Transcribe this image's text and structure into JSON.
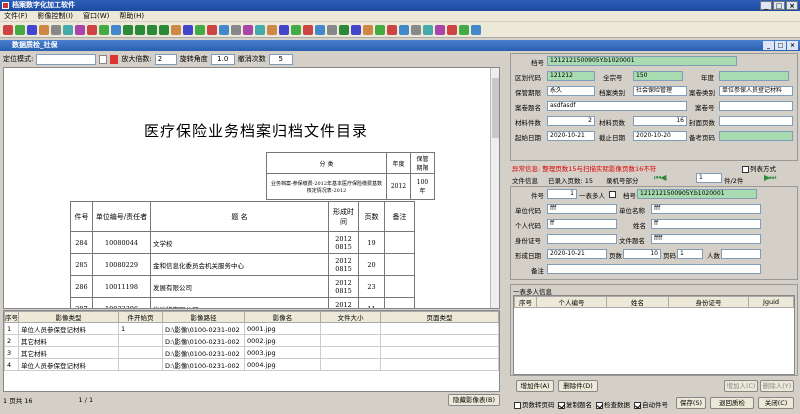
{
  "app": {
    "title": "档案数字化加工软件"
  },
  "menu": [
    "文件(F)",
    "影像控制(I)",
    "窗口(W)",
    "帮助(H)"
  ],
  "window": {
    "title": "数据质检_社保"
  },
  "controls": {
    "locate_label": "定位模式:",
    "zoom_label": "放大倍数:",
    "zoom_value": "2",
    "rotate_label": "旋转角度",
    "rotate_value": "1.0",
    "undo_label": "撤消次数",
    "undo_value": "5"
  },
  "document": {
    "title": "医疗保险业务档案归档文件目录",
    "cat_header": [
      "分 类",
      "年度",
      "保管期限"
    ],
    "cat_row": [
      "业务档案-参保缴费-2012年基本医疗保险缴费基数核定情况表-2012",
      "2012",
      "100年"
    ],
    "headers": [
      "件号",
      "单位编号/责任者",
      "题 名",
      "形成时间",
      "页数",
      "备注"
    ],
    "rows": [
      [
        "284",
        "10080044",
        "文学校",
        "2012 0815",
        "19",
        ""
      ],
      [
        "285",
        "10080229",
        "金和信息化委员会机关服务中心",
        "2012 0815",
        "20",
        ""
      ],
      [
        "286",
        "10011198",
        "发展有限公司",
        "2012 0815",
        "23",
        ""
      ],
      [
        "287",
        "10033396",
        "发动物有限公司",
        "2012 0815",
        "11",
        ""
      ]
    ]
  },
  "image_grid": {
    "headers": [
      "序号",
      "影像类型",
      "件开始页",
      "影像路径",
      "影像名",
      "文件大小",
      "页面类型"
    ],
    "rows": [
      [
        "1",
        "单位人员参保登记材料",
        "1",
        "D:\\影像\\0100-0231-002",
        "0001.jpg",
        "",
        ""
      ],
      [
        "2",
        "其它材料",
        "",
        "D:\\影像\\0100-0231-002",
        "0002.jpg",
        "",
        ""
      ],
      [
        "3",
        "其它材料",
        "",
        "D:\\影像\\0100-0231-002",
        "0003.jpg",
        "",
        ""
      ],
      [
        "4",
        "单位人员参保登记材料",
        "",
        "D:\\影像\\0100-0231-002",
        "0004.jpg",
        "",
        ""
      ]
    ]
  },
  "status": {
    "pages_label": "1  页共  16",
    "page_of": "1 / 1",
    "hide_button": "隐藏影像表(B)"
  },
  "record": {
    "dh_label": "档号",
    "dh": "1212121500905Y.b1020001",
    "qh_label": "区划代码",
    "qh": "121212",
    "qzh_label": "全宗号",
    "qzh": "150",
    "nd_label": "年度",
    "bgqx_label": "保管期限",
    "bgqx": "永久",
    "dalb_label": "档案类别",
    "dalb": "社会保险管理",
    "dalb2_label": "案卷类别",
    "dalb2": "单位参保人员登记材料",
    "ajtm_label": "案卷题名",
    "ajtm": "asdfasdf",
    "ajh_label": "案卷号",
    "clj_label": "材料件数",
    "clj": "2",
    "clys_label": "材料页数",
    "clys": "16",
    "fmys_label": "封面页数",
    "qsrq_label": "起始日期",
    "qsrq": "2020-10-21",
    "jzrq_label": "截止日期",
    "jzrq": "2020-10-20",
    "bbym_label": "备考页码"
  },
  "alert": "异常信息: 整理页数15与扫描实际影像页数16不符",
  "list_mode": "列表方式",
  "file_info": {
    "label": "文件信息",
    "entered": "已录入页数: 15",
    "entry_part": "录机号部分",
    "page": "1",
    "page_of": "件/2件"
  },
  "file_form": {
    "jh_label": "件号",
    "jh": "1",
    "one_table": "一表多人",
    "dh_label": "档号",
    "dh": "1212121500905Y.b1020001",
    "dwdm_label": "单位代码",
    "dwdm": "fff",
    "dwmc_label": "单位名称",
    "dwmc": "fff",
    "grdm_label": "个人代码",
    "grdm": "ff",
    "xm_label": "姓名",
    "xm": "ff",
    "sfz_label": "身份证号",
    "wjtm_label": "文件题名",
    "wjtm": "ffff",
    "xcrq_label": "形成日期",
    "xcrq": "2020-10-21",
    "ys_label": "页数",
    "ys": "10",
    "yh_label": "页码",
    "yh": "1",
    "rs_label": "人数",
    "bz_label": "备注"
  },
  "multi": {
    "title": "一表多人信息",
    "headers": [
      "序号",
      "个人编号",
      "姓名",
      "身份证号",
      "Jguid"
    ]
  },
  "buttons": {
    "add": "增加件(A)",
    "del": "删除件(D)",
    "add_person": "增加人(C)",
    "del_person": "删除人(Y)",
    "c1": "页数转页码",
    "c2": "复制题名",
    "c3": "检查数据",
    "c4": "自动件号",
    "save": "保存(S)",
    "back": "退回质检",
    "close": "关闭(C)"
  }
}
